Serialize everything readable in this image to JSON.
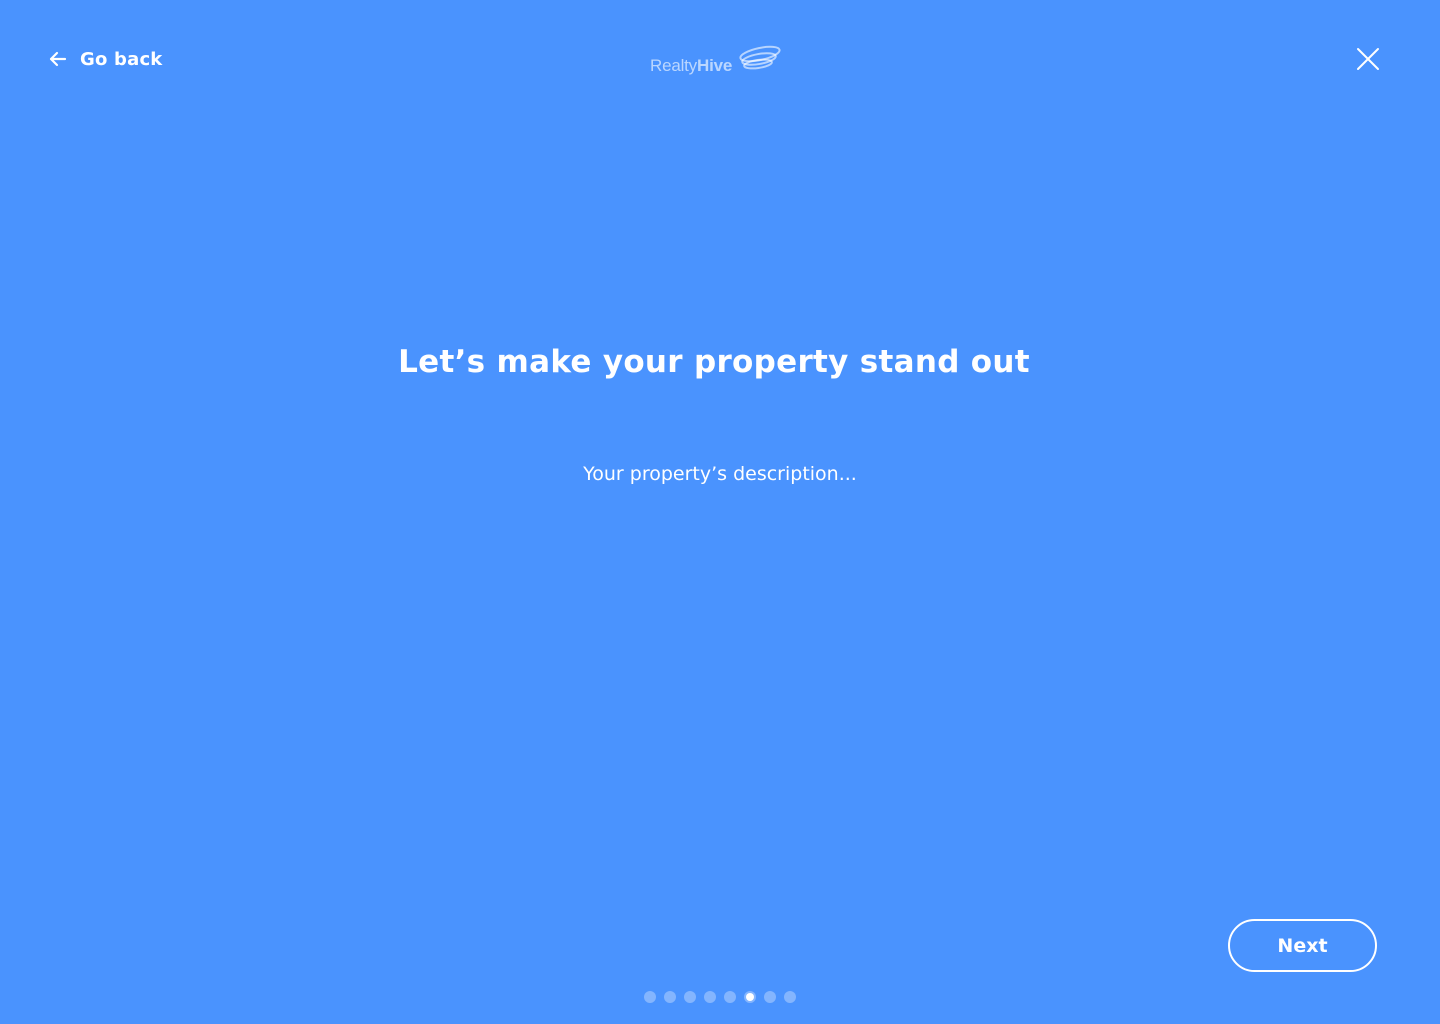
{
  "header": {
    "back_label": "Go back",
    "back_icon": "arrow-left-icon",
    "close_icon": "close-icon",
    "logo": {
      "text_light": "Realty",
      "text_bold": "Hive"
    }
  },
  "main": {
    "headline": "Let’s make your property stand out",
    "description_placeholder": "Your property’s description...",
    "description_value": ""
  },
  "footer": {
    "next_label": "Next",
    "pager": {
      "total_steps": 8,
      "current_step": 6
    }
  },
  "colors": {
    "background": "#4a93fe",
    "foreground": "#ffffff"
  }
}
